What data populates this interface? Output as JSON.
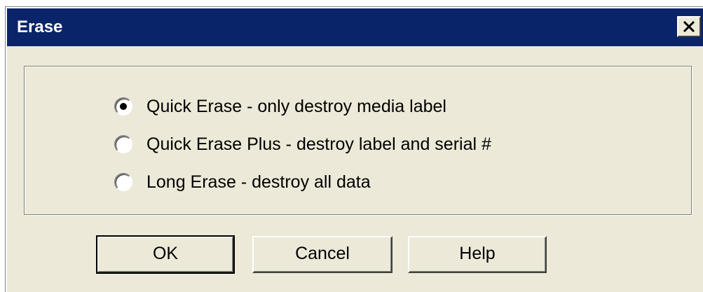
{
  "window": {
    "title": "Erase",
    "close_icon": "close-x-icon"
  },
  "options": [
    {
      "label": "Quick Erase - only destroy media label",
      "selected": true
    },
    {
      "label": "Quick Erase Plus - destroy label and serial #",
      "selected": false
    },
    {
      "label": "Long Erase - destroy all data",
      "selected": false
    }
  ],
  "buttons": {
    "ok_label": "OK",
    "cancel_label": "Cancel",
    "help_label": "Help"
  },
  "colors": {
    "titlebar": "#0a246a",
    "dialog_bg": "#ece9d8"
  }
}
